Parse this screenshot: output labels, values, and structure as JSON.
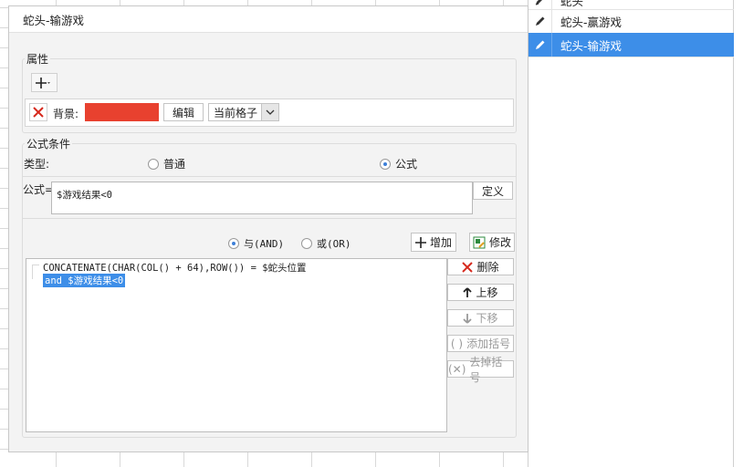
{
  "side_list": {
    "items": [
      {
        "label": "蛇头",
        "selected": false,
        "icon": "pencil-icon"
      },
      {
        "label": "蛇头-赢游戏",
        "selected": false,
        "icon": "pencil-icon"
      },
      {
        "label": "蛇头-输游戏",
        "selected": true,
        "icon": "pencil-icon"
      }
    ]
  },
  "dialog": {
    "title": "蛇头-输游戏",
    "attributes": {
      "section_label": "属性",
      "add_button": "+",
      "background_label": "背景:",
      "background_color": "#e8412f",
      "edit_button": "编辑",
      "scope_value": "当前格子"
    },
    "formula_condition": {
      "section_label": "公式条件",
      "type_label": "类型:",
      "option_normal": "普通",
      "option_formula": "公式",
      "selected_type": "formula",
      "formula_label": "公式=",
      "formula_value": "$游戏结果<0",
      "define_button": "定义",
      "and_label": "与(AND)",
      "or_label": "或(OR)",
      "selected_logic": "and",
      "add_button": "增加",
      "modify_button": "修改",
      "conditions": [
        "CONCATENATE(CHAR(COL() + 64),ROW()) = $蛇头位置",
        "and $游戏结果<0"
      ],
      "selected_condition_index": 1,
      "delete_button": "删除",
      "move_up_button": "上移",
      "move_down_button": "下移",
      "add_bracket_button": "添加括号",
      "remove_bracket_button": "去掉括号"
    }
  }
}
